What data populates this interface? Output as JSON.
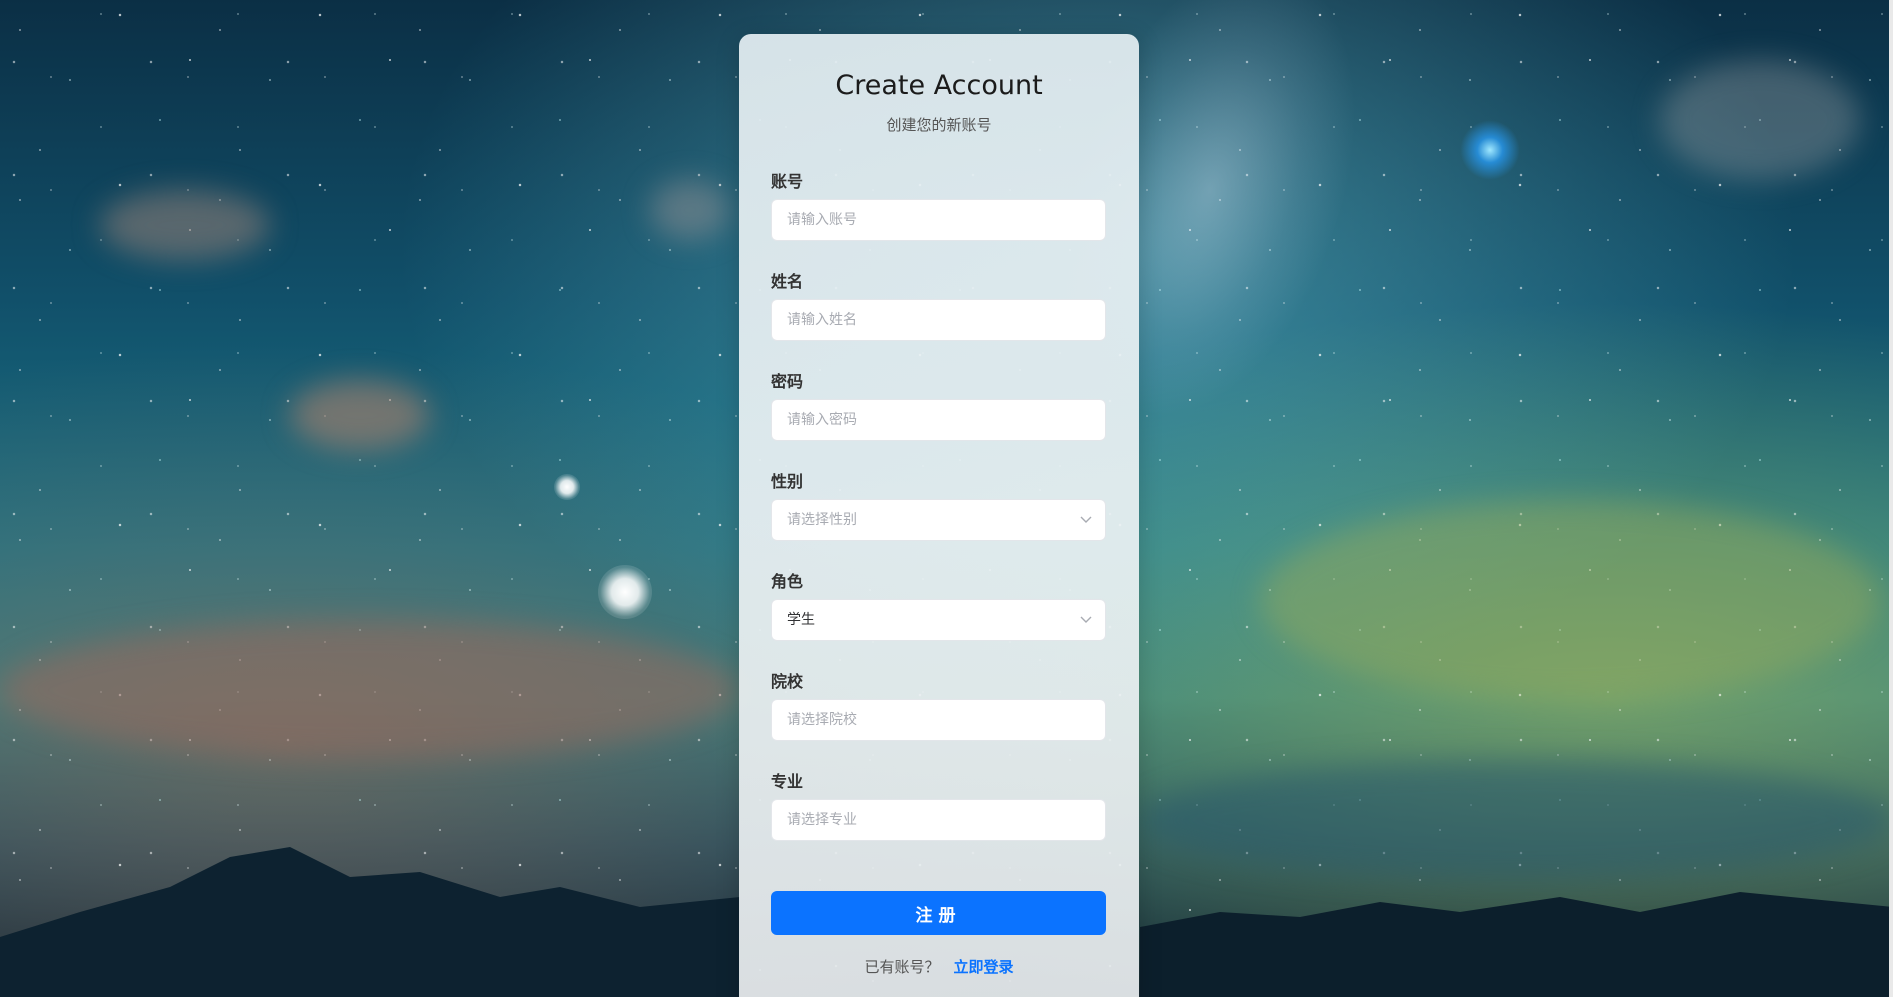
{
  "header": {
    "title": "Create Account",
    "subtitle": "创建您的新账号"
  },
  "form": {
    "account": {
      "label": "账号",
      "placeholder": "请输入账号"
    },
    "name": {
      "label": "姓名",
      "placeholder": "请输入姓名"
    },
    "password": {
      "label": "密码",
      "placeholder": "请输入密码"
    },
    "gender": {
      "label": "性别",
      "placeholder": "请选择性别",
      "value": ""
    },
    "role": {
      "label": "角色",
      "value": "学生"
    },
    "school": {
      "label": "院校",
      "placeholder": "请选择院校"
    },
    "major": {
      "label": "专业",
      "placeholder": "请选择专业"
    },
    "submit_label": "注册"
  },
  "footer": {
    "prompt": "已有账号？",
    "login_link": "立即登录"
  },
  "colors": {
    "accent": "#0b73ff",
    "panel": "#e6eef1"
  },
  "icons": {
    "dropdown": "chevron-down-icon"
  }
}
